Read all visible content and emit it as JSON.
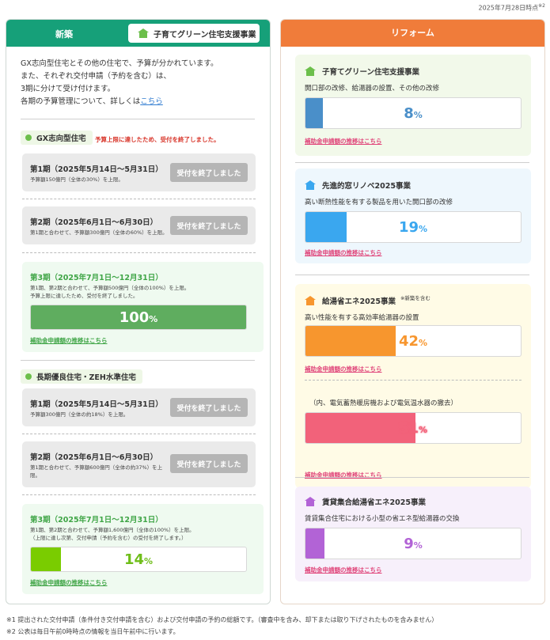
{
  "timestamp": "2025年7月28日時点",
  "timestamp_ref": "※2",
  "left": {
    "header_title": "新築",
    "badge": "子育てグリーン住宅支援事業",
    "intro": [
      "GX志向型住宅とその他の住宅で、予算が分かれています。",
      "また、それぞれ交付申請（予約を含む）は、",
      "3期に分けて受け付けます。",
      "各期の予算管理について、詳しくは"
    ],
    "intro_link": "こちら",
    "gx": {
      "label": "GX志向型住宅",
      "notice": "予算上限に達したため、受付を終了しました。",
      "p1_title": "第1期（2025年5月14日～5月31日）",
      "p1_desc": "予算額150億円（全体の30%）を上限。",
      "p1_button": "受付を終了しました",
      "p2_title": "第2期（2025年6月1日～6月30日）",
      "p2_desc": "第1期と合わせて、予算額300億円（全体の60%）を上限。",
      "p2_button": "受付を終了しました",
      "p3_title": "第3期（2025年7月1日～12月31日）",
      "p3_desc1": "第1期、第2期と合わせて、予算額500億円（全体の100%）を上限。",
      "p3_desc2": "予算上限に達したため、受付を終了しました。",
      "p3_pct": "100",
      "p3_link": "補助金申請額の推移はこちら"
    },
    "zeh": {
      "label": "長期優良住宅・ZEH水準住宅",
      "p1_title": "第1期（2025年5月14日～5月31日）",
      "p1_desc": "予算額300億円（全体の約18%）を上限。",
      "p1_button": "受付を終了しました",
      "p2_title": "第2期（2025年6月1日～6月30日）",
      "p2_desc1": "第1期と合わせて、予算額600億円（全体の約37%）を上",
      "p2_desc2": "限。",
      "p2_button": "受付を終了しました",
      "p3_title": "第3期（2025年7月1日～12月31日）",
      "p3_desc1": "第1期、第2期と合わせて、予算額1,600億円（全体の100%）を上限。",
      "p3_desc2": "（上限に達し次第、交付申請（予約を含む）の受付を終了します。）",
      "p3_pct": "14",
      "p3_link": "補助金申請額の推移はこちら"
    }
  },
  "right": {
    "header_title": "リフォーム",
    "c1_title": "子育てグリーン住宅支援事業",
    "c1_desc": "開口部の改修、給湯器の設置、その他の改修",
    "c1_pct": "8",
    "c1_link": "補助金申請額の推移はこちら",
    "c2_title": "先進的窓リノベ2025事業",
    "c2_desc": "高い断熱性能を有する製品を用いた開口部の改修",
    "c2_pct": "19",
    "c2_link": "補助金申請額の推移はこちら",
    "c3_title": "給湯省エネ2025事業",
    "c3_note": "※新築を含む",
    "c3_desc": "高い性能を有する高効率給湯器の設置",
    "c3_pct": "42",
    "c3_link": "補助金申請額の推移はこちら",
    "c3b_desc": "（内、電気蓄熱暖房機および電気温水器の撤去）",
    "c3b_pct": "51",
    "c3b_link": "補助金申請額の推移はこちら",
    "c4_title": "賃貸集合給湯省エネ2025事業",
    "c4_desc": "賃貸集合住宅における小型の省エネ型給湯器の交換",
    "c4_pct": "9",
    "c4_link": "補助金申請額の推移はこちら"
  },
  "percent_sign": "%",
  "footnotes": [
    "※1  提出された交付申請（条件付き交付申請を含む）および交付申請の予約の総額です。（審査中を含み、却下または取り下げされたものを含みません）",
    "※2  公表は毎日午前0時時点の情報を当日午前中に行います。"
  ],
  "colors": {
    "green_header": "#16a079",
    "orange_header": "#f07c3a",
    "gx_fill": "#5fad5f",
    "zeh_fill": "#7acc00",
    "c1_fill": "#4a8fc9",
    "c2_fill": "#3aa7ef",
    "c3_fill": "#f7962e",
    "c3b_fill": "#f2627a",
    "c4_fill": "#b263d6",
    "link_pink": "#e0457a"
  }
}
